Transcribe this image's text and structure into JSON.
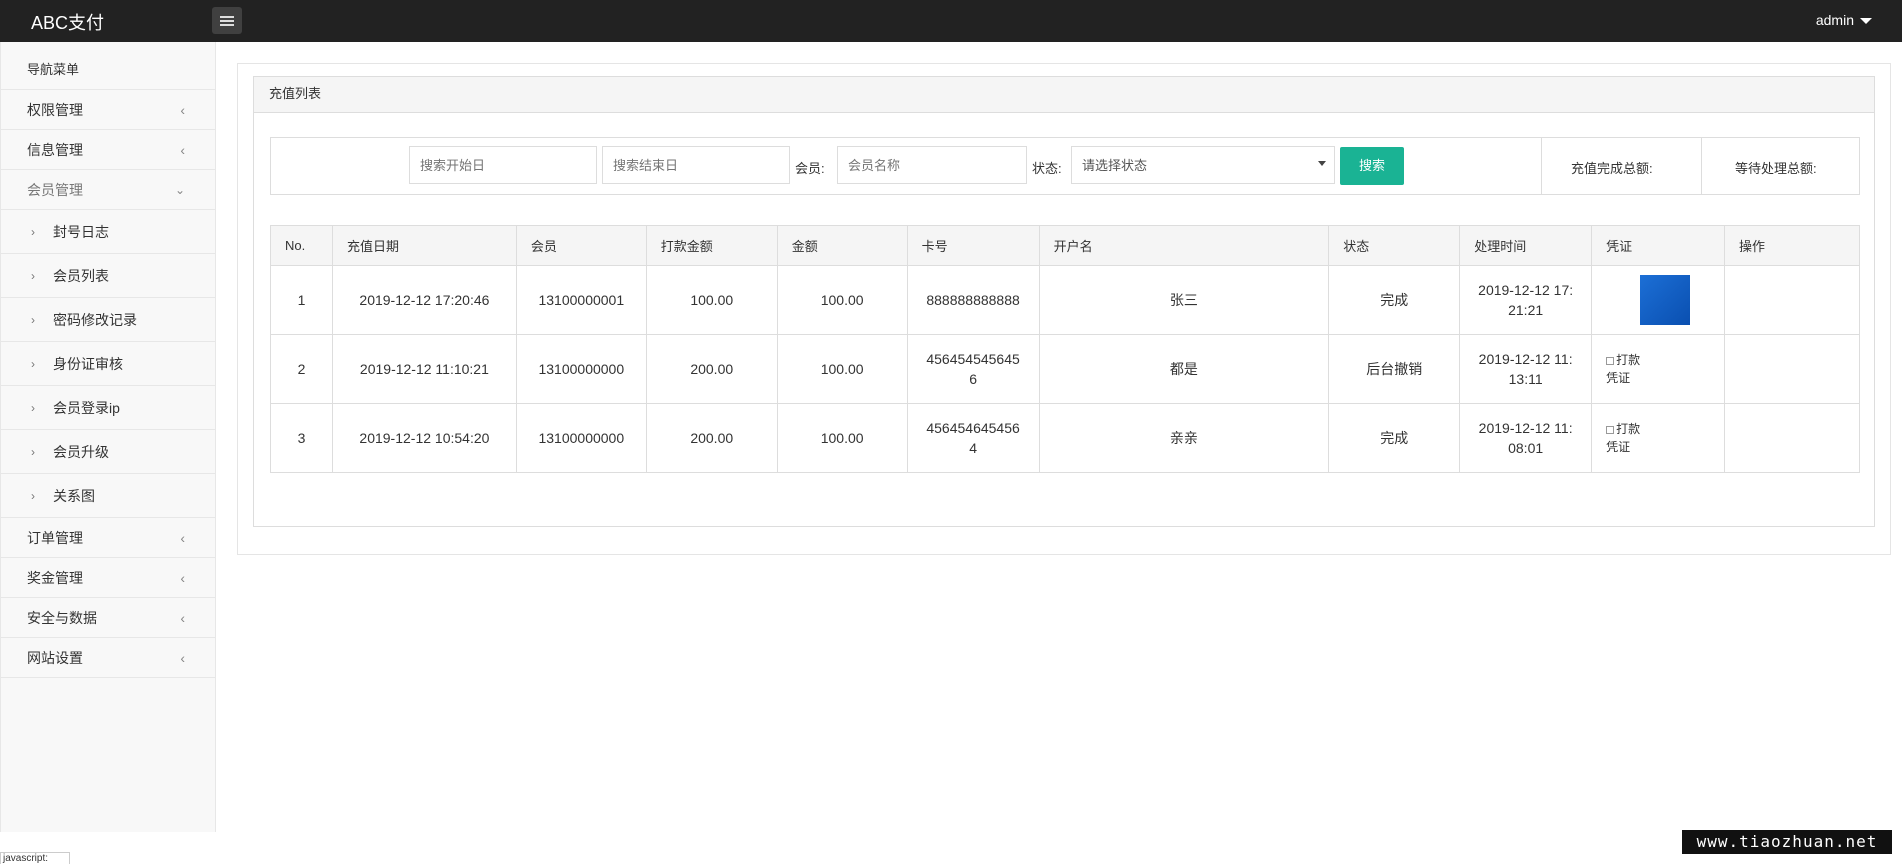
{
  "header": {
    "brand": "ABC支付",
    "user": "admin"
  },
  "sidebar": {
    "title": "导航菜单",
    "items": [
      {
        "label": "权限管理"
      },
      {
        "label": "信息管理"
      },
      {
        "label": "会员管理",
        "expanded": true
      },
      {
        "label": "订单管理"
      },
      {
        "label": "奖金管理"
      },
      {
        "label": "安全与数据"
      },
      {
        "label": "网站设置"
      }
    ],
    "member_sub": [
      "封号日志",
      "会员列表",
      "密码修改记录",
      "身份证审核",
      "会员登录ip",
      "会员升级",
      "关系图"
    ]
  },
  "panel": {
    "title": "充值列表"
  },
  "search": {
    "start_placeholder": "搜索开始日",
    "end_placeholder": "搜索结束日",
    "member_label": "会员:",
    "member_placeholder": "会员名称",
    "status_label": "状态:",
    "status_placeholder": "请选择状态",
    "button": "搜索",
    "total_done_label": "充值完成总额:",
    "total_pending_label": "等待处理总额:"
  },
  "table": {
    "columns": [
      "No.",
      "充值日期",
      "会员",
      "打款金额",
      "金额",
      "卡号",
      "开户名",
      "状态",
      "处理时间",
      "凭证",
      "操作"
    ],
    "rows": [
      {
        "no": "1",
        "date": "2019-12-12 17:20:46",
        "member": "13100000001",
        "paid": "100.00",
        "amount": "100.00",
        "card_1": "888888888888",
        "card_2": "",
        "name": "张三",
        "status": "完成",
        "time_1": "2019-12-12 17:",
        "time_2": "21:21",
        "proof": "image",
        "proof_alt_1": "",
        "proof_alt_2": ""
      },
      {
        "no": "2",
        "date": "2019-12-12 11:10:21",
        "member": "13100000000",
        "paid": "200.00",
        "amount": "100.00",
        "card_1": "456454545645",
        "card_2": "6",
        "name": "都是",
        "status": "后台撤销",
        "time_1": "2019-12-12 11:",
        "time_2": "13:11",
        "proof": "broken",
        "proof_alt_1": "打款",
        "proof_alt_2": "凭证"
      },
      {
        "no": "3",
        "date": "2019-12-12 10:54:20",
        "member": "13100000000",
        "paid": "200.00",
        "amount": "100.00",
        "card_1": "456454645456",
        "card_2": "4",
        "name": "亲亲",
        "status": "完成",
        "time_1": "2019-12-12 11:",
        "time_2": "08:01",
        "proof": "broken",
        "proof_alt_1": "打款",
        "proof_alt_2": "凭证"
      }
    ]
  },
  "watermark": "www.tiaozhuan.net",
  "footer_tag": "javascript:"
}
